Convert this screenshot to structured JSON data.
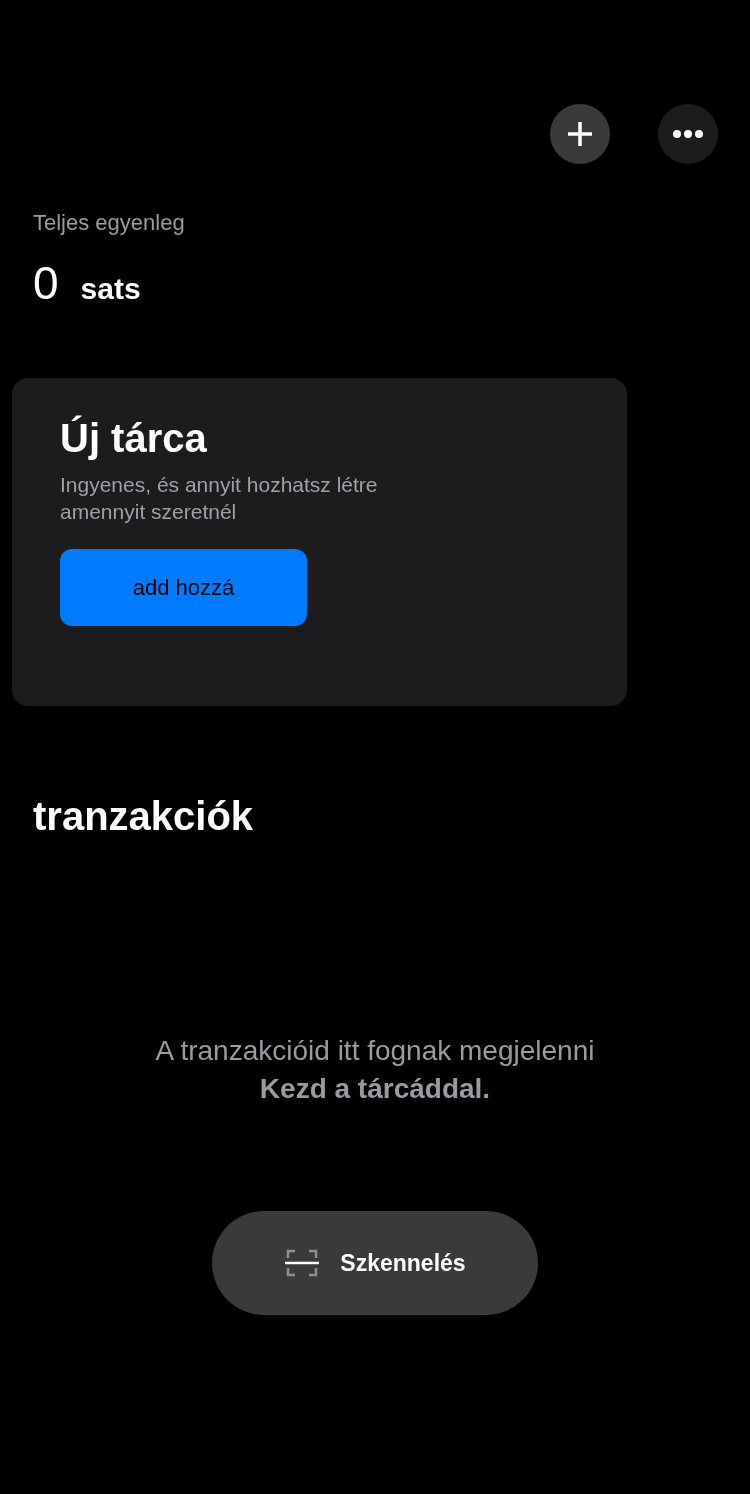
{
  "header": {
    "actions": [
      {
        "kind": "add"
      },
      {
        "kind": "more"
      }
    ]
  },
  "balance": {
    "label": "Teljes egyenleg",
    "amount": "0",
    "unit": "sats"
  },
  "wallet_card": {
    "title": "Új tárca",
    "description": "Ingyenes, és annyit hozhatsz létre amennyit szeretnél",
    "button": "add hozzá"
  },
  "transactions": {
    "title": "tranzakciók",
    "empty_message": "A tranzakcióid itt fognak megjelenni",
    "empty_hint": "Kezd a tárcáddal."
  },
  "scan_button": {
    "label": "Szkennelés"
  }
}
